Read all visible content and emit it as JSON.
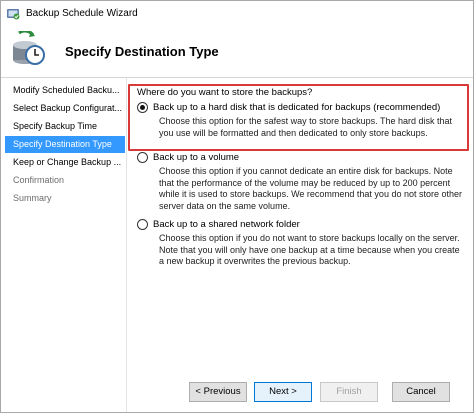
{
  "window": {
    "title": "Backup Schedule Wizard",
    "icon": "backup-wizard-icon"
  },
  "header": {
    "title": "Specify Destination Type",
    "icon": "backup-clock-icon"
  },
  "sidebar": {
    "items": [
      {
        "label": "Modify Scheduled Backu...",
        "state": "normal"
      },
      {
        "label": "Select Backup Configurat...",
        "state": "normal"
      },
      {
        "label": "Specify Backup Time",
        "state": "normal"
      },
      {
        "label": "Specify Destination Type",
        "state": "active"
      },
      {
        "label": "Keep or Change Backup ...",
        "state": "normal"
      },
      {
        "label": "Confirmation",
        "state": "disabled"
      },
      {
        "label": "Summary",
        "state": "disabled"
      }
    ]
  },
  "main": {
    "question": "Where do you want to store the backups?",
    "options": [
      {
        "label": "Back up to a hard disk that is dedicated for backups (recommended)",
        "selected": true,
        "description": "Choose this option for the safest way to store backups. The hard disk that you use will be formatted and then dedicated to only store backups."
      },
      {
        "label": "Back up to a volume",
        "selected": false,
        "description": "Choose this option if you cannot dedicate an entire disk for backups. Note that the performance of the volume may be reduced by up to 200 percent while it is used to store backups. We recommend that you do not store other server data on the same volume."
      },
      {
        "label": "Back up to a shared network folder",
        "selected": false,
        "description": "Choose this option if you do not want to store backups locally on the server. Note that you will only have one backup at a time because when you create a new backup it overwrites the previous backup."
      }
    ]
  },
  "buttons": {
    "previous": "< Previous",
    "next": "Next >",
    "finish": "Finish",
    "cancel": "Cancel"
  },
  "colors": {
    "selected_nav": "#3399ff",
    "highlight_border": "#d83a3a"
  }
}
